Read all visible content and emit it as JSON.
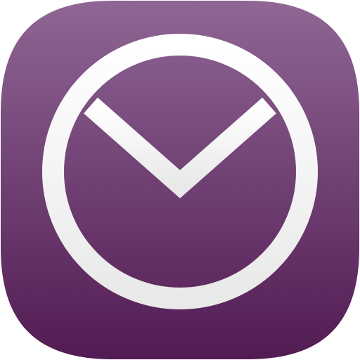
{
  "app_icon": {
    "name": "y-circle-logo-icon",
    "colors": {
      "tile_gradient_top": "#8f6694",
      "tile_gradient_bottom": "#521b53",
      "glyph_top": "#ffffff",
      "glyph_bottom": "#e9e9e9"
    }
  }
}
